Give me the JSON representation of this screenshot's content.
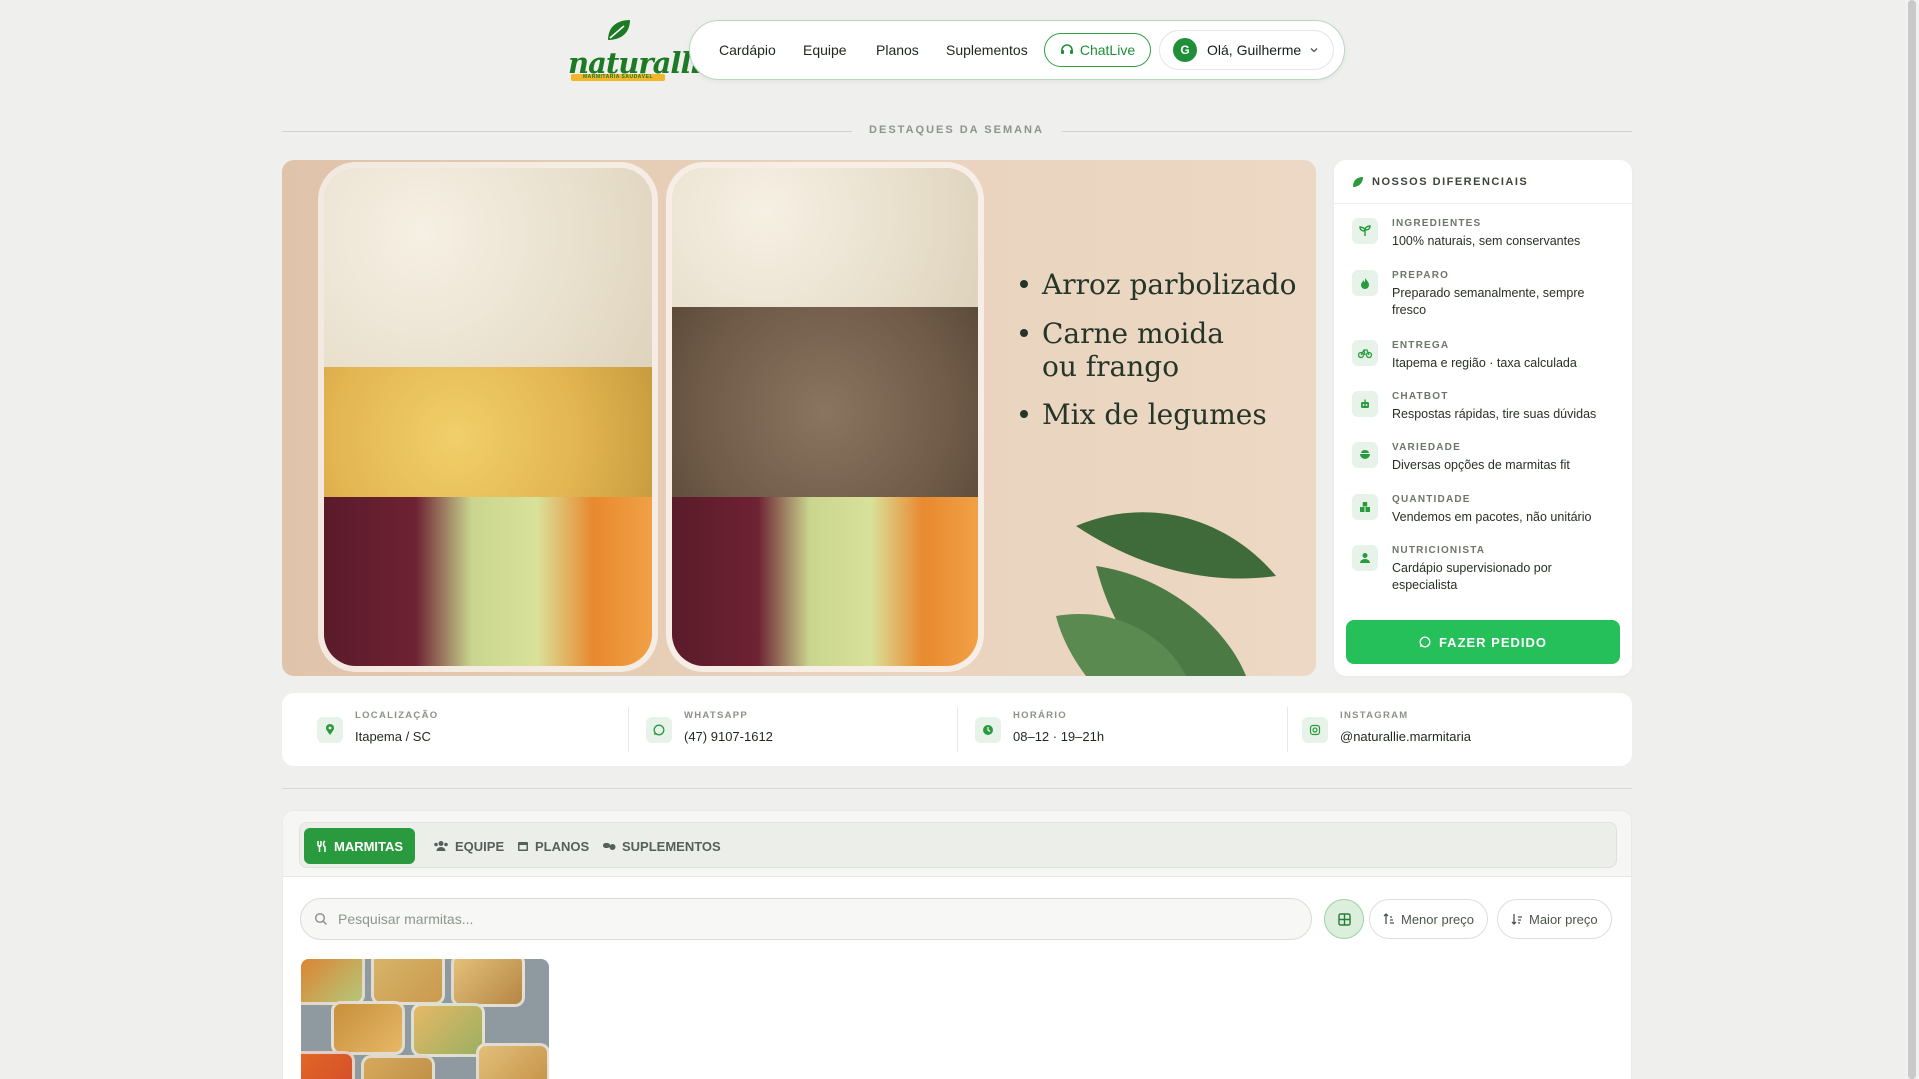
{
  "brand": {
    "name": "naturallie",
    "tagline": "MARMITARIA SAUDÁVEL"
  },
  "nav": {
    "links": [
      "Cardápio",
      "Equipe",
      "Planos",
      "Suplementos"
    ],
    "chat_label": "ChatLive",
    "user_initial": "G",
    "user_greeting": "Olá, Guilherme"
  },
  "section_title": "DESTAQUES DA SEMANA",
  "hero": {
    "bullets": [
      "Arroz parbolizado",
      "Carne moida",
      "ou frango",
      "Mix de legumes"
    ]
  },
  "features": {
    "title": "NOSSOS DIFERENCIAIS",
    "items": [
      {
        "key": "INGREDIENTES",
        "value": "100% naturais, sem conservantes",
        "icon": "sprout-icon"
      },
      {
        "key": "PREPARO",
        "value": "Preparado semanalmente, sempre fresco",
        "icon": "flame-icon"
      },
      {
        "key": "ENTREGA",
        "value": "Itapema e região · taxa calculada",
        "icon": "bicycle-icon"
      },
      {
        "key": "CHATBOT",
        "value": "Respostas rápidas, tire suas dúvidas",
        "icon": "robot-icon"
      },
      {
        "key": "VARIEDADE",
        "value": "Diversas opções de marmitas fit",
        "icon": "bowl-icon"
      },
      {
        "key": "QUANTIDADE",
        "value": "Vendemos em pacotes, não unitário",
        "icon": "boxes-icon"
      },
      {
        "key": "NUTRICIONISTA",
        "value": "Cardápio supervisionado por especialista",
        "icon": "user-doctor-icon"
      }
    ],
    "order_label": "FAZER PEDIDO"
  },
  "info": [
    {
      "key": "LOCALIZAÇÃO",
      "value": "Itapema / SC",
      "icon": "map-pin-icon"
    },
    {
      "key": "WHATSAPP",
      "value": "(47) 9107-1612",
      "icon": "whatsapp-icon"
    },
    {
      "key": "HORÁRIO",
      "value": "08–12 · 19–21h",
      "icon": "clock-icon"
    },
    {
      "key": "INSTAGRAM",
      "value": "@naturallie.marmitaria",
      "icon": "instagram-icon"
    }
  ],
  "tabs": [
    {
      "label": "MARMITAS",
      "active": true
    },
    {
      "label": "EQUIPE",
      "active": false
    },
    {
      "label": "PLANOS",
      "active": false
    },
    {
      "label": "SUPLEMENTOS",
      "active": false
    }
  ],
  "search": {
    "placeholder": "Pesquisar marmitas..."
  },
  "sort": {
    "asc_label": "Menor preço",
    "desc_label": "Maior preço"
  },
  "colors": {
    "accent": "#2a9a3e",
    "order_button": "#25c05a",
    "background": "#eff0ed"
  }
}
